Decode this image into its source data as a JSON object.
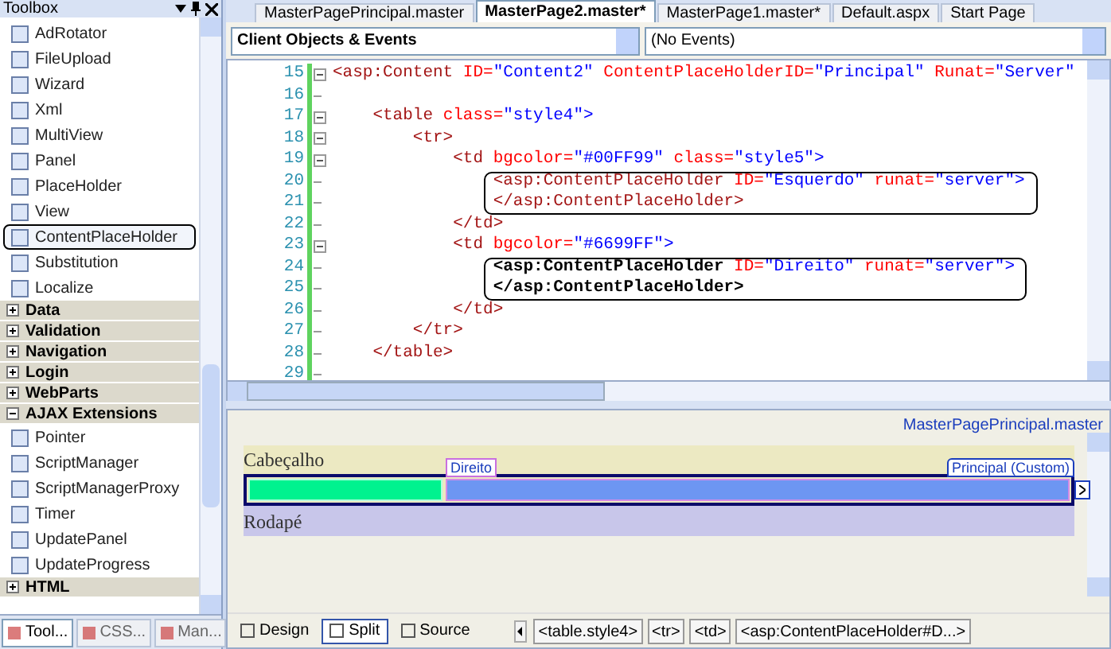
{
  "toolbox": {
    "title": "Toolbox",
    "items": [
      {
        "kind": "item",
        "label": "AdRotator",
        "selected": false
      },
      {
        "kind": "item",
        "label": "FileUpload",
        "selected": false
      },
      {
        "kind": "item",
        "label": "Wizard",
        "selected": false
      },
      {
        "kind": "item",
        "label": "Xml",
        "selected": false
      },
      {
        "kind": "item",
        "label": "MultiView",
        "selected": false
      },
      {
        "kind": "item",
        "label": "Panel",
        "selected": false
      },
      {
        "kind": "item",
        "label": "PlaceHolder",
        "selected": false
      },
      {
        "kind": "item",
        "label": "View",
        "selected": false
      },
      {
        "kind": "item",
        "label": "ContentPlaceHolder",
        "selected": true
      },
      {
        "kind": "item",
        "label": "Substitution",
        "selected": false
      },
      {
        "kind": "item",
        "label": "Localize",
        "selected": false
      },
      {
        "kind": "category",
        "label": "Data",
        "expanded": false
      },
      {
        "kind": "category",
        "label": "Validation",
        "expanded": false
      },
      {
        "kind": "category",
        "label": "Navigation",
        "expanded": false
      },
      {
        "kind": "category",
        "label": "Login",
        "expanded": false
      },
      {
        "kind": "category",
        "label": "WebParts",
        "expanded": false
      },
      {
        "kind": "category",
        "label": "AJAX Extensions",
        "expanded": true
      },
      {
        "kind": "item",
        "label": "Pointer",
        "selected": false
      },
      {
        "kind": "item",
        "label": "ScriptManager",
        "selected": false
      },
      {
        "kind": "item",
        "label": "ScriptManagerProxy",
        "selected": false
      },
      {
        "kind": "item",
        "label": "Timer",
        "selected": false
      },
      {
        "kind": "item",
        "label": "UpdatePanel",
        "selected": false
      },
      {
        "kind": "item",
        "label": "UpdateProgress",
        "selected": false
      },
      {
        "kind": "category",
        "label": "HTML",
        "expanded": false
      }
    ],
    "tabs": [
      {
        "label": "Tool...",
        "selected": true
      },
      {
        "label": "CSS...",
        "selected": false
      },
      {
        "label": "Man...",
        "selected": false
      }
    ]
  },
  "document_tabs": [
    {
      "label": "MasterPagePrincipal.master",
      "selected": false
    },
    {
      "label": "MasterPage2.master*",
      "selected": true
    },
    {
      "label": "MasterPage1.master*",
      "selected": false
    },
    {
      "label": "Default.aspx",
      "selected": false
    },
    {
      "label": "Start Page",
      "selected": false
    }
  ],
  "object_dropdown": "Client Objects & Events",
  "event_dropdown": "(No Events)",
  "code": [
    {
      "number": "15",
      "fold_box": true,
      "boxed": false,
      "tokens": [
        {
          "kind": "tag",
          "text": "<asp:Content"
        },
        {
          "kind": "attr",
          "text": " ID="
        },
        {
          "kind": "value",
          "text": "\"Content2\""
        },
        {
          "kind": "attr",
          "text": " ContentPlaceHolderID="
        },
        {
          "kind": "value",
          "text": "\"Principal\""
        },
        {
          "kind": "attr",
          "text": " Runat="
        },
        {
          "kind": "value",
          "text": "\"Server\""
        }
      ]
    },
    {
      "number": "16",
      "fold_box": false,
      "boxed": false
    },
    {
      "number": "17",
      "fold_box": true,
      "boxed": false,
      "tokens": [
        {
          "kind": "tag",
          "text": "    <table"
        },
        {
          "kind": "attr",
          "text": " class="
        },
        {
          "kind": "value",
          "text": "\"style4\">"
        }
      ]
    },
    {
      "number": "18",
      "fold_box": true,
      "boxed": false,
      "tokens": [
        {
          "kind": "tag",
          "text": "        <tr>"
        }
      ]
    },
    {
      "number": "19",
      "fold_box": true,
      "boxed": false,
      "tokens": [
        {
          "kind": "tag",
          "text": "            <td"
        },
        {
          "kind": "attr",
          "text": " bgcolor="
        },
        {
          "kind": "value",
          "text": "\"#00FF99\""
        },
        {
          "kind": "attr",
          "text": " class="
        },
        {
          "kind": "value",
          "text": "\"style5\">"
        }
      ]
    },
    {
      "number": "20",
      "fold_box": false,
      "boxed": true,
      "tokens": [
        {
          "kind": "tag",
          "text": "                <asp:ContentPlaceHolder"
        },
        {
          "kind": "attr",
          "text": " ID="
        },
        {
          "kind": "value",
          "text": "\"Esquerdo\""
        },
        {
          "kind": "attr",
          "text": " runat="
        },
        {
          "kind": "value",
          "text": "\"server\">"
        }
      ]
    },
    {
      "number": "21",
      "fold_box": false,
      "boxed": true,
      "tokens": [
        {
          "kind": "tag",
          "text": "                </asp:ContentPlaceHolder>"
        }
      ]
    },
    {
      "number": "22",
      "fold_box": false,
      "boxed": false,
      "tokens": [
        {
          "kind": "tag",
          "text": "            </td>"
        }
      ]
    },
    {
      "number": "23",
      "fold_box": true,
      "boxed": false,
      "tokens": [
        {
          "kind": "tag",
          "text": "            <td"
        },
        {
          "kind": "attr",
          "text": " bgcolor="
        },
        {
          "kind": "value",
          "text": "\"#6699FF\">"
        }
      ]
    },
    {
      "number": "24",
      "fold_box": false,
      "boxed": true,
      "tokens": [
        {
          "kind": "bold",
          "text": "                <asp:ContentPlaceHolder"
        },
        {
          "kind": "attr",
          "text": " ID="
        },
        {
          "kind": "value",
          "text": "\"Direito\""
        },
        {
          "kind": "attr",
          "text": " runat="
        },
        {
          "kind": "value",
          "text": "\"server\">"
        }
      ]
    },
    {
      "number": "25",
      "fold_box": false,
      "boxed": true,
      "tokens": [
        {
          "kind": "bold",
          "text": "                </asp:ContentPlaceHolder>"
        }
      ]
    },
    {
      "number": "26",
      "fold_box": false,
      "boxed": false,
      "tokens": [
        {
          "kind": "tag",
          "text": "            </td>"
        }
      ]
    },
    {
      "number": "27",
      "fold_box": false,
      "boxed": false,
      "tokens": [
        {
          "kind": "tag",
          "text": "        </tr>"
        }
      ]
    },
    {
      "number": "28",
      "fold_box": false,
      "boxed": false,
      "tokens": [
        {
          "kind": "tag",
          "text": "    </table>"
        }
      ]
    },
    {
      "number": "29",
      "fold_box": false,
      "boxed": false
    }
  ],
  "design": {
    "master_label": "MasterPagePrincipal.master",
    "header": "Cabeçalho",
    "right_label": "Direito",
    "content_label": "Principal (Custom)",
    "footer": "Rodapé"
  },
  "view_tabs": [
    {
      "label": "Design",
      "selected": false
    },
    {
      "label": "Split",
      "selected": true
    },
    {
      "label": "Source",
      "selected": false
    }
  ],
  "breadcrumb": [
    "<table.style4>",
    "<tr>",
    "<td>",
    "<asp:ContentPlaceHolder#D...>"
  ]
}
